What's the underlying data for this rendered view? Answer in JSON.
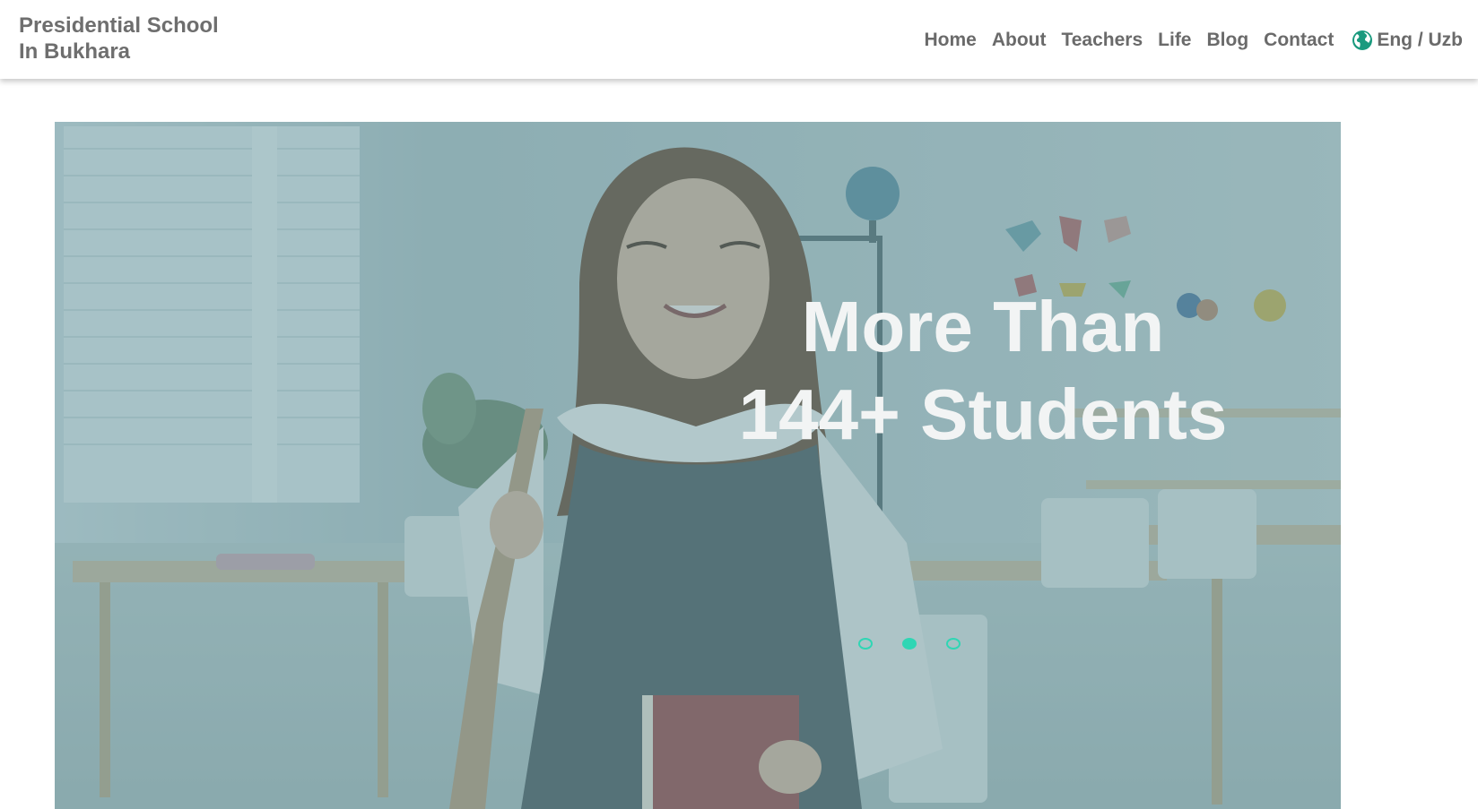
{
  "header": {
    "logo_line1": "Presidential School",
    "logo_line2": "In Bukhara",
    "nav": [
      "Home",
      "About",
      "Teachers",
      "Life",
      "Blog",
      "Contact"
    ],
    "language": "Eng / Uzb"
  },
  "hero": {
    "title_line1": "More Than",
    "title_line2": "144+ Students",
    "slides": [
      {
        "active": false
      },
      {
        "active": true
      },
      {
        "active": false
      }
    ]
  },
  "colors": {
    "accent": "#1a9a7e",
    "dot": "#2fd6b4",
    "overlay": "#5f8f96"
  },
  "icons": {
    "language": "globe-icon"
  }
}
